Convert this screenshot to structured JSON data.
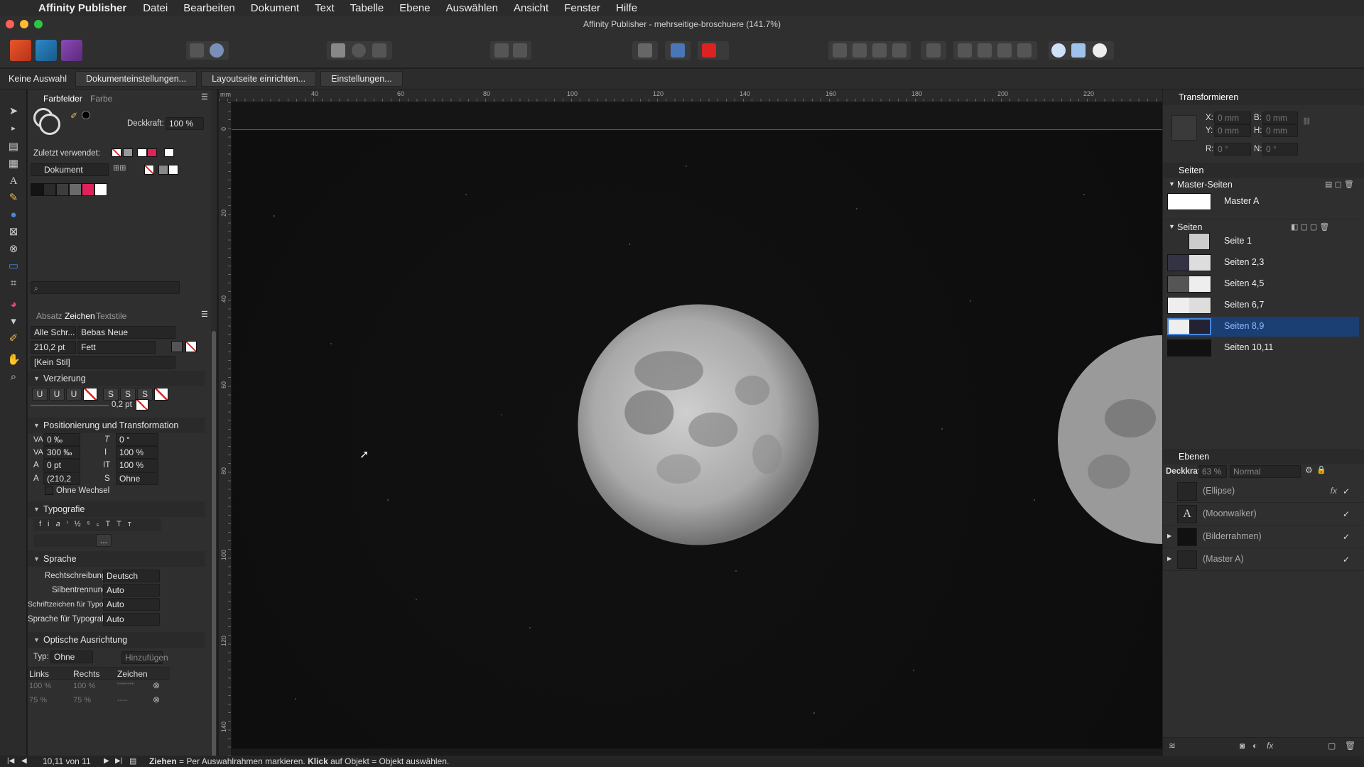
{
  "menubar": {
    "app": "Affinity Publisher",
    "items": [
      "Datei",
      "Bearbeiten",
      "Dokument",
      "Text",
      "Tabelle",
      "Ebene",
      "Auswählen",
      "Ansicht",
      "Fenster",
      "Hilfe"
    ]
  },
  "window": {
    "title": "Affinity Publisher - mehrseitige-broschuere (141.7%)"
  },
  "contextbar": {
    "selection": "Keine Auswahl",
    "buttons": [
      "Dokumenteinstellungen...",
      "Layoutseite einrichten...",
      "Einstellungen..."
    ]
  },
  "swatches": {
    "tabs": [
      "Farbfelder",
      "Farbe"
    ],
    "opacity_label": "Deckkraft:",
    "opacity_value": "100 %",
    "recent_label": "Zuletzt verwendet:",
    "palette": "Dokument",
    "palette_colors": [
      "#141414",
      "#2a2a2a",
      "#3d3d3d",
      "#6a6a6a",
      "#e0225b",
      "#ffffff"
    ]
  },
  "character": {
    "tabs": [
      "Absatz",
      "Zeichen",
      "Textstile"
    ],
    "font_collection": "Alle Schr...",
    "font_family": "Bebas Neue",
    "font_size": "210,2 pt",
    "font_weight": "Fett",
    "style": "[Kein Stil]",
    "decoration_header": "Verzierung",
    "decoration_buttons": [
      "U",
      "U",
      "U",
      "S",
      "S",
      "S"
    ],
    "stroke_value": "0,2 pt",
    "position_header": "Positionierung und Transformation",
    "kerning": "0 ‰",
    "tracking": "300 ‰",
    "baseline": "0 pt",
    "leading": "(210,2",
    "skew": "0 °",
    "vertical_scale": "100 %",
    "horizontal_scale": "100 %",
    "shear_label": "Ohne",
    "no_break_label": "Ohne Wechsel",
    "typography_header": "Typografie",
    "typography_more": "...",
    "language_header": "Sprache",
    "spelling_label": "Rechtschreibung:",
    "spelling_value": "Deutsch",
    "hyphenation_label": "Silbentrennung:",
    "hyphenation_value": "Auto",
    "typo_chars_label": "Schriftzeichen für Typografie:",
    "typo_chars_value": "Auto",
    "typo_lang_label": "Sprache für Typografie:",
    "typo_lang_value": "Auto",
    "optical_header": "Optische Ausrichtung",
    "type_label": "Typ:",
    "type_value": "Ohne",
    "add_button": "Hinzufügen",
    "table_headers": [
      "Links",
      "Rechts",
      "Zeichen"
    ],
    "table_rows": [
      [
        "100 %",
        "100 %",
        "\"\"\"\"\"\"'\""
      ],
      [
        "75 %",
        "75 %",
        "----"
      ]
    ]
  },
  "ruler": {
    "unit": "mm",
    "h_ticks": [
      "40",
      "60",
      "80",
      "100",
      "120",
      "140",
      "160",
      "180",
      "200",
      "220"
    ],
    "v_ticks": [
      "0",
      "20",
      "40",
      "60",
      "80",
      "100",
      "120",
      "140"
    ]
  },
  "transform": {
    "header": "Transformieren",
    "x_label": "X:",
    "x_value": "0 mm",
    "y_label": "Y:",
    "y_value": "0 mm",
    "w_label": "B:",
    "w_value": "0 mm",
    "h_label": "H:",
    "h_value": "0 mm",
    "r_label": "R:",
    "r_value": "0 °",
    "s_label": "N:",
    "s_value": "0 °"
  },
  "pages": {
    "header": "Seiten",
    "masters_header": "Master-Seiten",
    "masters": [
      "Master A"
    ],
    "pages_header": "Seiten",
    "items": [
      "Seite 1",
      "Seiten 2,3",
      "Seiten 4,5",
      "Seiten 6,7",
      "Seiten 8,9",
      "Seiten 10,11"
    ],
    "selected_index": 4
  },
  "layers": {
    "header": "Ebenen",
    "opacity_label": "Deckkraft:",
    "opacity_value": "63 %",
    "blend_mode": "Normal",
    "items": [
      "(Ellipse)",
      "(Moonwalker)",
      "(Bilderrahmen)",
      "(Master A)"
    ]
  },
  "statusbar": {
    "page_indicator": "10,11 von 11",
    "hint_bold1": "Ziehen",
    "hint_text1": " = Per Auswahlrahmen markieren. ",
    "hint_bold2": "Klick",
    "hint_text2": " auf Objekt = Objekt auswählen."
  }
}
